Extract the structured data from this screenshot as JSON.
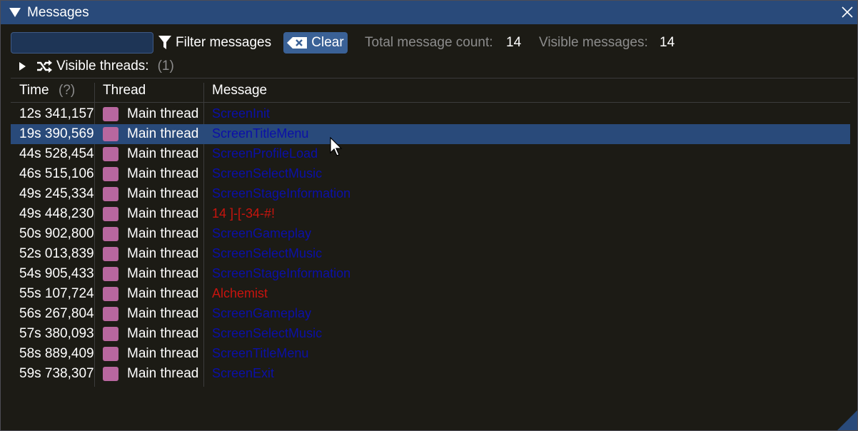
{
  "window": {
    "title": "Messages"
  },
  "toolbar": {
    "filter_value": "",
    "filter_label": "Filter messages",
    "clear_label": "Clear",
    "total_label": "Total message count:",
    "total_value": "14",
    "visible_label": "Visible messages:",
    "visible_value": "14"
  },
  "threads": {
    "label": "Visible threads:",
    "count": "(1)"
  },
  "table": {
    "columns": {
      "time": "Time",
      "time_help": "(?)",
      "thread": "Thread",
      "message": "Message"
    },
    "rows": [
      {
        "time": "12s 341,157",
        "thread": "Main thread",
        "message": "ScreenInit"
      },
      {
        "time": "19s 390,569",
        "thread": "Main thread",
        "message": "ScreenTitleMenu"
      },
      {
        "time": "44s 528,454",
        "thread": "Main thread",
        "message": "ScreenProfileLoad"
      },
      {
        "time": "46s 515,106",
        "thread": "Main thread",
        "message": "ScreenSelectMusic"
      },
      {
        "time": "49s 245,334",
        "thread": "Main thread",
        "message": "ScreenStageInformation"
      },
      {
        "time": "49s 448,230",
        "thread": "Main thread",
        "message": "14 ]-[-34-#!"
      },
      {
        "time": "50s 902,800",
        "thread": "Main thread",
        "message": "ScreenGameplay"
      },
      {
        "time": "52s 013,839",
        "thread": "Main thread",
        "message": "ScreenSelectMusic"
      },
      {
        "time": "54s 905,433",
        "thread": "Main thread",
        "message": "ScreenStageInformation"
      },
      {
        "time": "55s 107,724",
        "thread": "Main thread",
        "message": "Alchemist"
      },
      {
        "time": "56s 267,804",
        "thread": "Main thread",
        "message": "ScreenGameplay"
      },
      {
        "time": "57s 380,093",
        "thread": "Main thread",
        "message": "ScreenSelectMusic"
      },
      {
        "time": "58s 889,409",
        "thread": "Main thread",
        "message": "ScreenTitleMenu"
      },
      {
        "time": "59s 738,307",
        "thread": "Main thread",
        "message": "ScreenExit"
      }
    ],
    "selected_row": 1
  },
  "colors": {
    "titlebar": "#294a7a",
    "window_bg": "#1c1b15",
    "thread_swatch": "#b8679f",
    "message_blue": "#0b10a8",
    "message_red": "#c8140e",
    "selected_row": "#294a7a"
  },
  "message_colors": [
    "blue",
    "blue",
    "blue",
    "blue",
    "blue",
    "red",
    "blue",
    "blue",
    "blue",
    "red",
    "blue",
    "blue",
    "blue",
    "blue"
  ]
}
